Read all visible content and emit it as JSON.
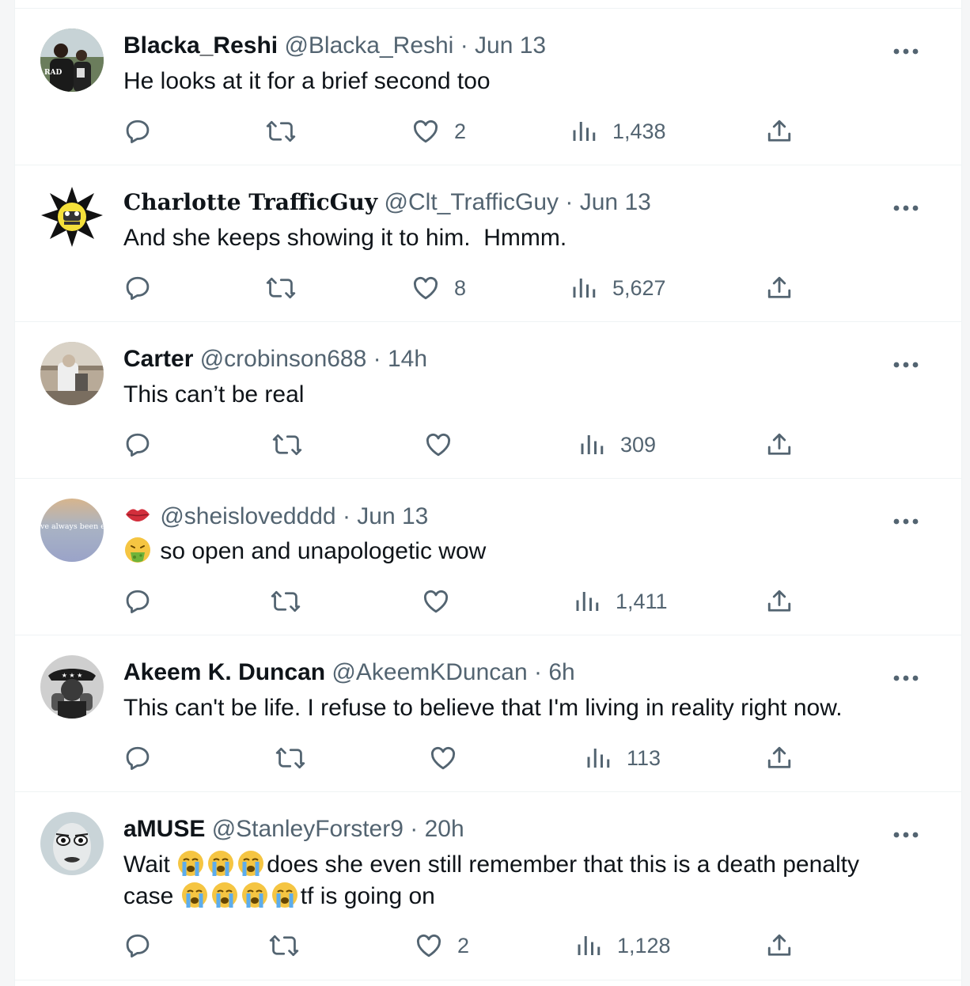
{
  "colors": {
    "text": "#0f1419",
    "muted": "#536471",
    "divider": "#eff3f4"
  },
  "tweets": [
    {
      "display_name": "Blacka_Reshi",
      "handle": "@Blacka_Reshi",
      "sep": "·",
      "time": "Jun 13",
      "text": "He looks at it for a brief second too",
      "likes": "2",
      "views": "1,438",
      "avatar_text": "RAD"
    },
    {
      "display_name": "Charlotte TrafficGuy",
      "handle": "@Clt_TrafficGuy",
      "sep": "·",
      "time": "Jun 13",
      "text": "And she keeps showing it to him.  Hmmm.",
      "likes": "8",
      "views": "5,627"
    },
    {
      "display_name": "Carter",
      "handle": "@crobinson688",
      "sep": "·",
      "time": "14h",
      "text": "This can’t be real",
      "likes": "",
      "views": "309"
    },
    {
      "display_name": "",
      "handle": "@sheislovedddd",
      "sep": "·",
      "time": "Jun 13",
      "text": "so open and unapologetic wow",
      "likes": "",
      "views": "1,411",
      "avatar_text": "you have always been enough"
    },
    {
      "display_name": "Akeem K. Duncan",
      "handle": "@AkeemKDuncan",
      "sep": "·",
      "time": "6h",
      "text": "This can't be life. I refuse to believe that I'm living in reality right now.",
      "likes": "",
      "views": "113"
    },
    {
      "display_name": "aMUSE",
      "handle": "@StanleyForster9",
      "sep": "·",
      "time": "20h",
      "text_a": "Wait ",
      "text_b": "does she even still remember that this is a death penalty case ",
      "text_c": "tf is going on",
      "likes": "2",
      "views": "1,128"
    }
  ]
}
